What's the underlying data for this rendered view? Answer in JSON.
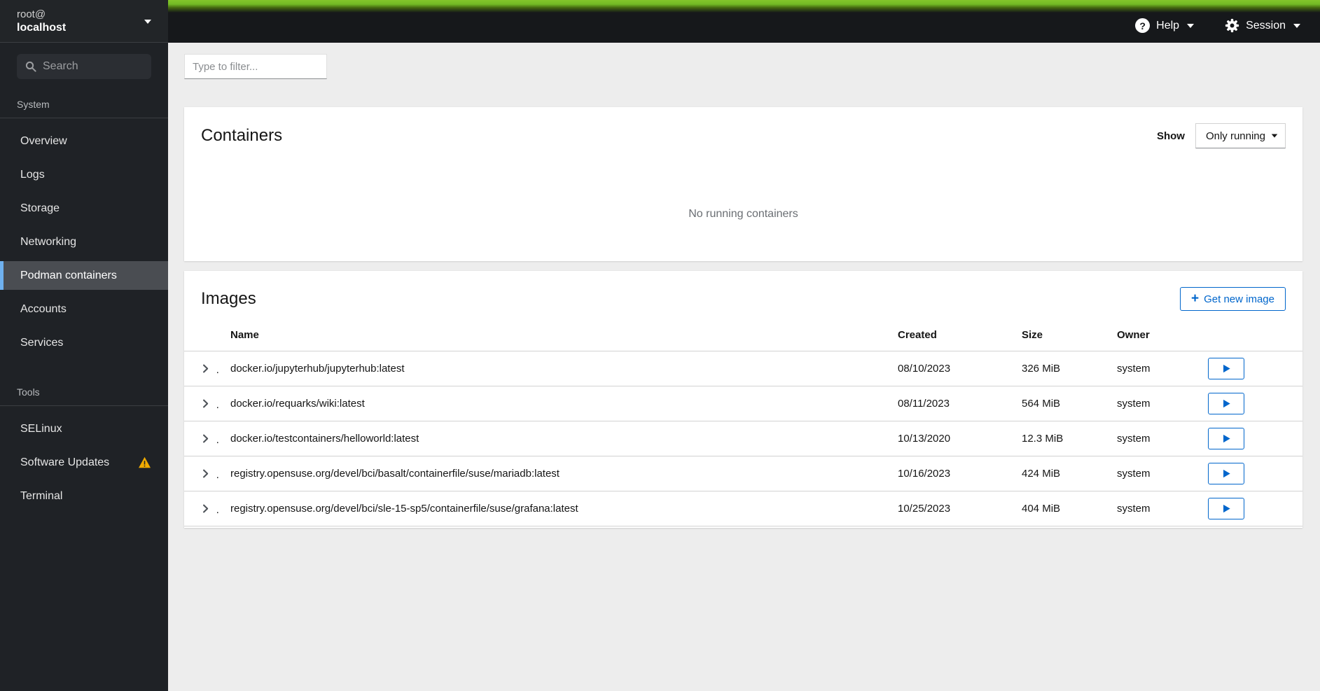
{
  "sidebar": {
    "user": {
      "line1": "root@",
      "line2": "localhost"
    },
    "search_placeholder": "Search",
    "sections": [
      {
        "label": "System",
        "items": [
          {
            "label": "Overview"
          },
          {
            "label": "Logs"
          },
          {
            "label": "Storage"
          },
          {
            "label": "Networking"
          },
          {
            "label": "Podman containers",
            "selected": true
          },
          {
            "label": "Accounts"
          },
          {
            "label": "Services"
          }
        ]
      },
      {
        "label": "Tools",
        "items": [
          {
            "label": "SELinux"
          },
          {
            "label": "Software Updates",
            "warning": true
          },
          {
            "label": "Terminal"
          }
        ]
      }
    ]
  },
  "masthead": {
    "help_label": "Help",
    "session_label": "Session"
  },
  "toolbar": {
    "filter_placeholder": "Type to filter..."
  },
  "containers_card": {
    "title": "Containers",
    "show_label": "Show",
    "show_filter_value": "Only running",
    "empty_message": "No running containers"
  },
  "images_card": {
    "title": "Images",
    "get_new_image_label": "Get new image",
    "columns": [
      "Name",
      "Created",
      "Size",
      "Owner"
    ],
    "rows": [
      {
        "name": "docker.io/jupyterhub/jupyterhub:latest",
        "created": "08/10/2023",
        "size": "326 MiB",
        "owner": "system"
      },
      {
        "name": "docker.io/requarks/wiki:latest",
        "created": "08/11/2023",
        "size": "564 MiB",
        "owner": "system"
      },
      {
        "name": "docker.io/testcontainers/helloworld:latest",
        "created": "10/13/2020",
        "size": "12.3 MiB",
        "owner": "system"
      },
      {
        "name": "registry.opensuse.org/devel/bci/basalt/containerfile/suse/mariadb:latest",
        "created": "10/16/2023",
        "size": "424 MiB",
        "owner": "system"
      },
      {
        "name": "registry.opensuse.org/devel/bci/sle-15-sp5/containerfile/suse/grafana:latest",
        "created": "10/25/2023",
        "size": "404 MiB",
        "owner": "system"
      }
    ]
  },
  "icons": {
    "help_glyph": "?",
    "plus_glyph": "+"
  },
  "colors": {
    "accent_blue": "#0066cc",
    "brand_green": "#73ba25",
    "warning_yellow": "#f0ab00",
    "nav_selected_accent": "#6fb1ef",
    "sidebar_bg": "#1f2226",
    "masthead_bg": "#16181b",
    "content_bg": "#ededed"
  }
}
